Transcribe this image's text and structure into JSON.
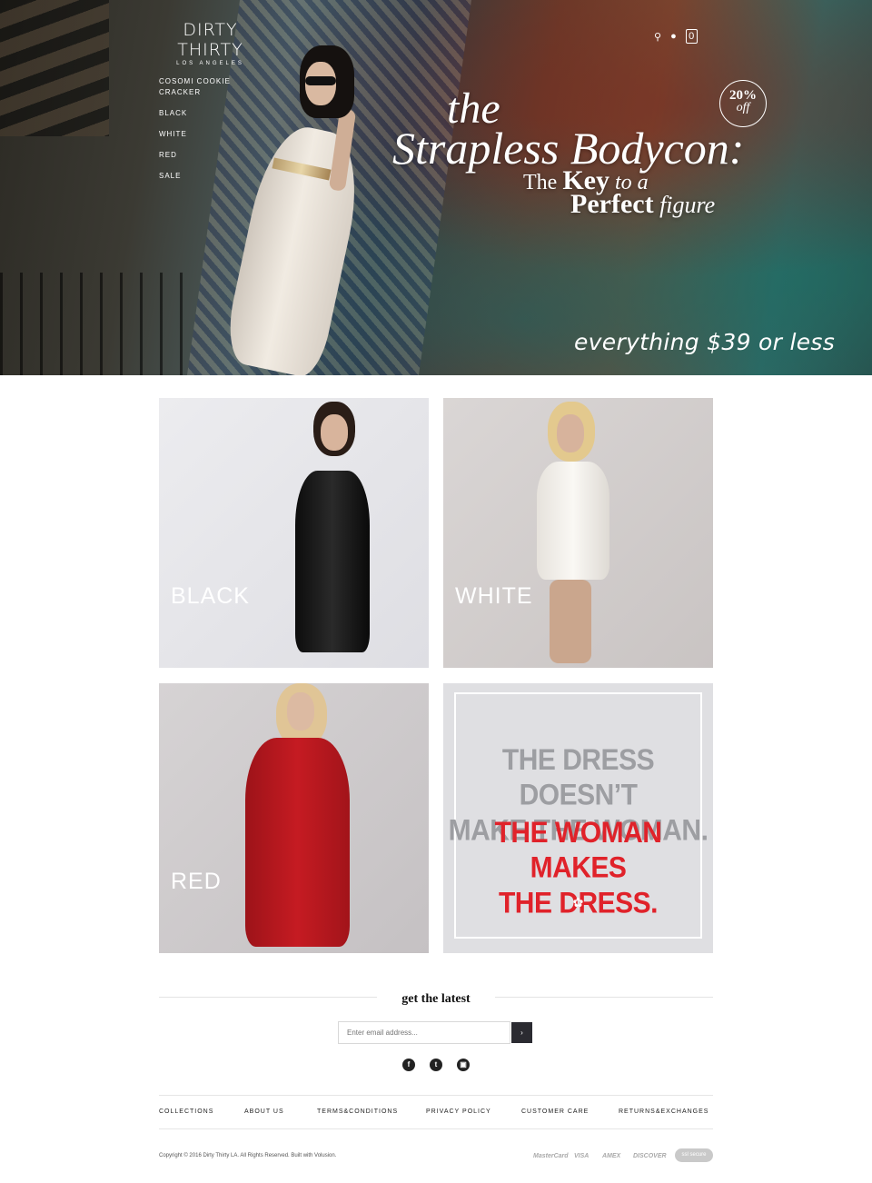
{
  "header": {
    "brand": "DIRTY THIRTY",
    "brand_sub": "LOS ANGELES",
    "nav": [
      "COSOMI COOKIE CRACKER",
      "BLACK",
      "WHITE",
      "RED",
      "SALE"
    ],
    "cart_count": "0"
  },
  "hero": {
    "badge_pct": "20%",
    "badge_off": "off",
    "line1": "the",
    "line2": "Strapless Bodycon:",
    "line3_a": "The ",
    "line3_b": "Key",
    "line3_c": " to a",
    "line4_a": "Perfect",
    "line4_b": " figure",
    "tagline": "everything $39 or less"
  },
  "collections": {
    "black_label": "BLACK",
    "white_label": "WHITE",
    "red_label": "RED"
  },
  "quote": {
    "grey_1": "THE DRESS DOESN’T",
    "grey_2": "MAKE THE WOMAN.",
    "red_1": "THE WOMAN MAKES",
    "red_2": "THE DRESS."
  },
  "newsletter": {
    "title": "get the latest",
    "placeholder": "Enter email address...",
    "submit": "›"
  },
  "social": {
    "facebook": "f",
    "twitter": "t",
    "instagram": "▣"
  },
  "footer": {
    "links": [
      "COLLECTIONS",
      "ABOUT US",
      "TERMS&CONDITIONS",
      "PRIVACY POLICY",
      "CUSTOMER CARE",
      "RETURNS&EXCHANGES"
    ],
    "copyright": "Copyright © 2016 Dirty Thirty LA. All Rights Reserved. Built with Volusion.",
    "payments": [
      "MasterCard",
      "VISA",
      "AMEX",
      "DISCOVER"
    ],
    "ssl": "ssl secure"
  },
  "colors": {
    "accent_red": "#e0222a",
    "quote_grey": "#9d9ea2",
    "button_dark": "#2b2b31"
  }
}
